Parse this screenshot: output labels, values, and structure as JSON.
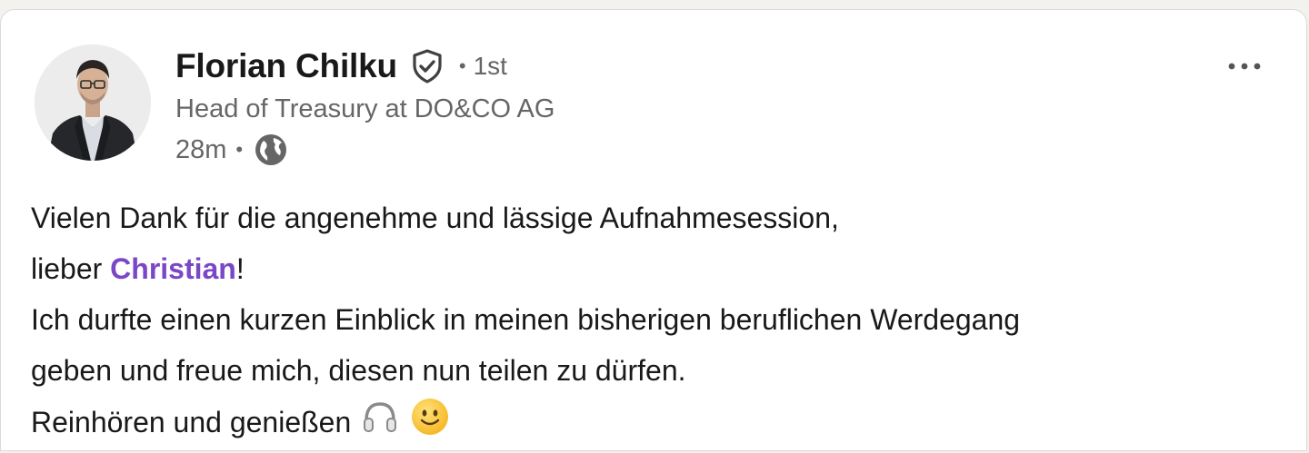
{
  "post": {
    "author": {
      "name": "Florian Chilku",
      "degree": "1st",
      "headline": "Head of Treasury at DO&CO AG",
      "time": "28m",
      "verified_icon": "verified-shield-icon",
      "visibility_icon": "globe-icon"
    },
    "more_icon": "more-options-icon",
    "body": {
      "line1": "Vielen Dank für die angenehme und lässige Aufnahmesession,",
      "line2_prefix": "lieber ",
      "mention": "Christian",
      "line2_suffix": "!",
      "line3": "Ich durfte einen kurzen Einblick in meinen bisherigen beruflichen Werdegang",
      "line4": "geben und freue mich, diesen nun teilen zu dürfen.",
      "line5": "Reinhören und genießen",
      "emojis": [
        "headphones-icon",
        "smiley-icon"
      ]
    }
  },
  "colors": {
    "mention": "#7a47c7",
    "text_primary": "#191919",
    "text_secondary": "#666666"
  }
}
